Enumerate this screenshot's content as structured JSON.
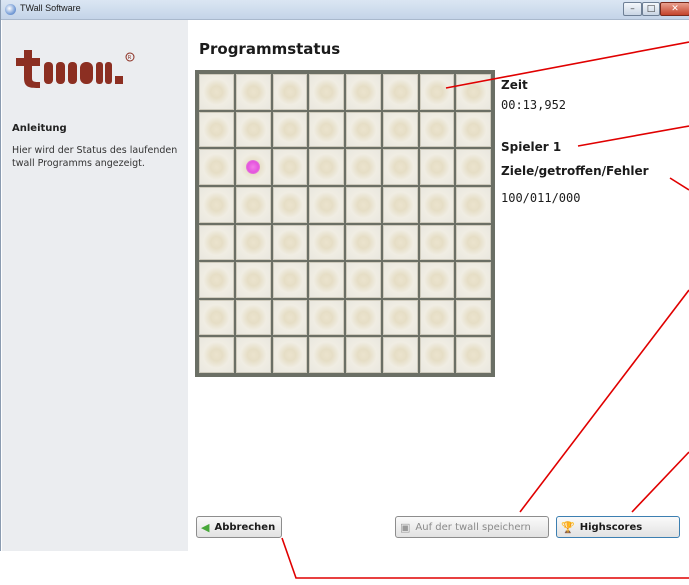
{
  "window": {
    "title": "TWall Software",
    "controls": {
      "minimize": "–",
      "maximize": "□",
      "close": "✕"
    }
  },
  "sidebar": {
    "heading": "Anleitung",
    "text": "Hier wird der Status des laufenden twall Programms angezeigt."
  },
  "main": {
    "title": "Programmstatus",
    "grid": {
      "rows": 8,
      "cols": 8,
      "highlighted": [
        {
          "row": 3,
          "col": 2
        }
      ]
    },
    "stats": {
      "time_label": "Zeit",
      "time_value": "00:13,952",
      "player_label": "Spieler 1",
      "score_label": "Ziele/getroffen/Fehler",
      "score_value": "100/011/000"
    }
  },
  "buttons": {
    "cancel": "Abbrechen",
    "save": "Auf der twall speichern",
    "highscores": "Highscores"
  },
  "colors": {
    "accent_pink": "#e454de",
    "annotation_red": "#e00000",
    "logo_brown": "#8c2f22"
  }
}
